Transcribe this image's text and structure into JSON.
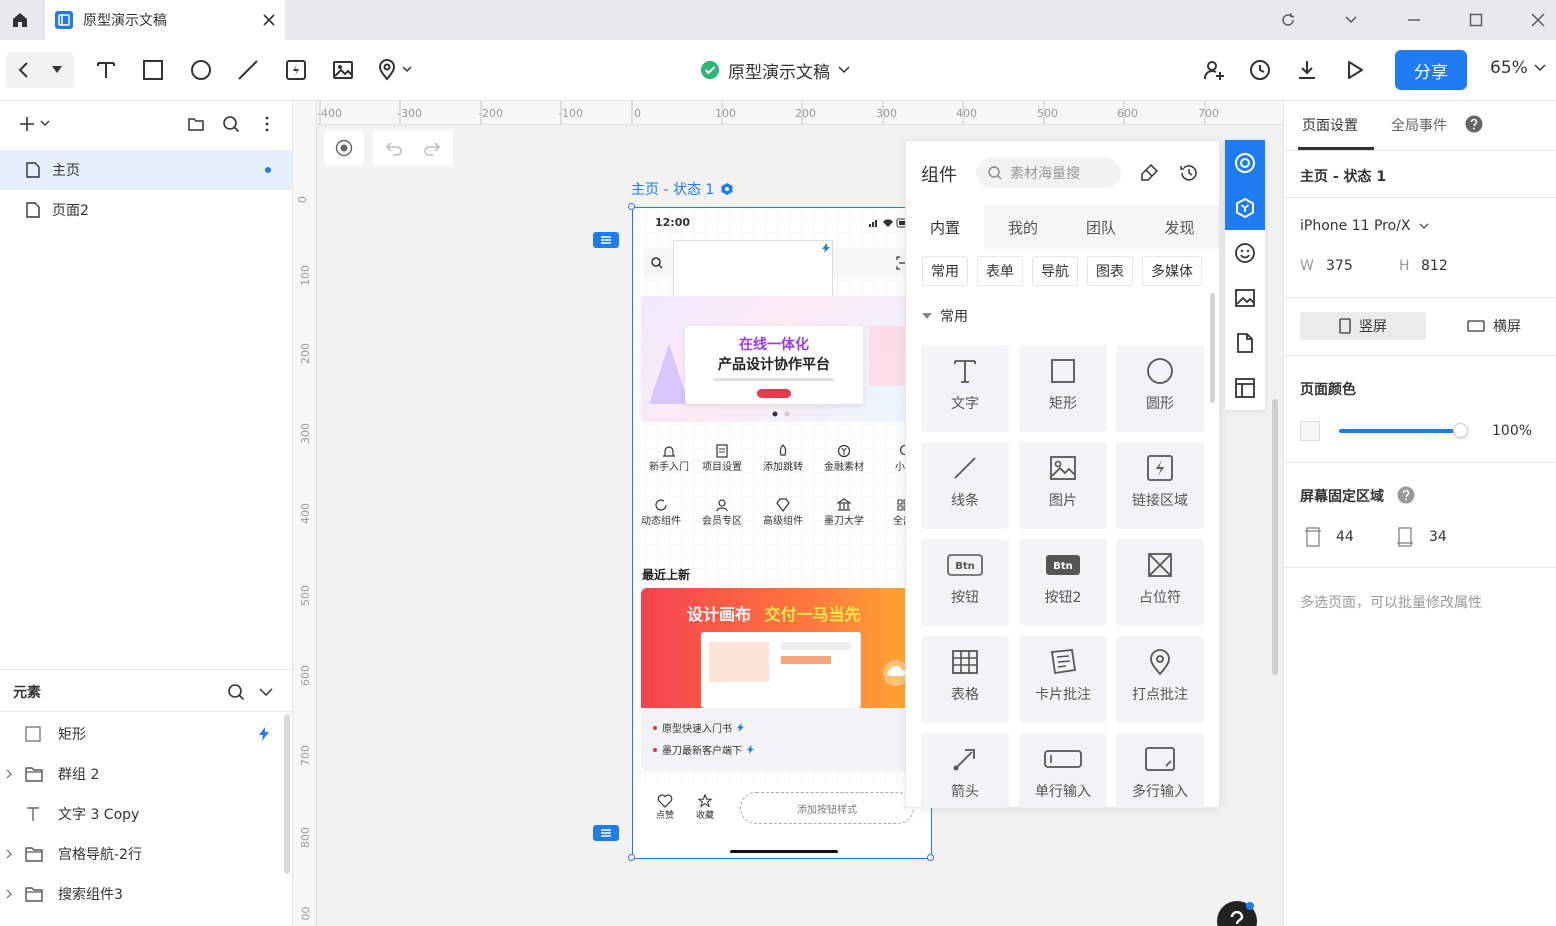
{
  "window": {
    "tab_title": "原型演示文稿"
  },
  "toolbar": {
    "doc_title": "原型演示文稿",
    "share_label": "分享",
    "zoom": "65%"
  },
  "pages_panel": {
    "pages": [
      {
        "label": "主页",
        "active": true
      },
      {
        "label": "页面2",
        "active": false
      }
    ]
  },
  "elements_panel": {
    "title": "元素",
    "items": [
      {
        "label": "矩形",
        "icon": "rect-icon",
        "expandable": false
      },
      {
        "label": "群组 2",
        "icon": "folder-icon",
        "expandable": true
      },
      {
        "label": "文字 3 Copy",
        "icon": "text-icon",
        "expandable": false
      },
      {
        "label": "宫格导航-2行",
        "icon": "folder-icon",
        "expandable": true
      },
      {
        "label": "搜索组件3",
        "icon": "folder-icon",
        "expandable": true
      }
    ]
  },
  "canvas": {
    "ruler_h": [
      "-400",
      "-300",
      "-200",
      "-100",
      "0",
      "100",
      "200",
      "300",
      "400",
      "500",
      "600",
      "700"
    ],
    "ruler_v": [
      "0",
      "100",
      "200",
      "300",
      "400",
      "500",
      "600",
      "700",
      "800",
      "00"
    ],
    "frame_label": "主页 - 状态 1"
  },
  "phone": {
    "time": "12:00",
    "banner_title_1": "在线一体化",
    "banner_title_2": "产品设计协作平台",
    "nav_row1": [
      "新手入门",
      "项目设置",
      "添加跳转",
      "金融素材",
      "小技"
    ],
    "nav_row2": [
      "动态组件",
      "会员专区",
      "高级组件",
      "墨刀大学",
      "全部"
    ],
    "recent_title": "最近上新",
    "promo_title_1": "设计画布",
    "promo_title_2": "交付一马当先",
    "list": [
      "原型快速入门书",
      "墨刀最新客户端下"
    ],
    "bottom": {
      "like": "点赞",
      "fav": "收藏",
      "button": "添加按钮样式"
    }
  },
  "components_panel": {
    "title": "组件",
    "search_placeholder": "素材海量搜",
    "tabs": [
      "内置",
      "我的",
      "团队",
      "发现"
    ],
    "categories": [
      "常用",
      "表单",
      "导航",
      "图表",
      "多媒体"
    ],
    "section": "常用",
    "tiles": [
      {
        "label": "文字",
        "icon": "text-icon"
      },
      {
        "label": "矩形",
        "icon": "rectangle-icon"
      },
      {
        "label": "圆形",
        "icon": "circle-icon"
      },
      {
        "label": "线条",
        "icon": "line-icon"
      },
      {
        "label": "图片",
        "icon": "image-icon"
      },
      {
        "label": "链接区域",
        "icon": "link-area-icon"
      },
      {
        "label": "按钮",
        "icon": "button-outline-icon"
      },
      {
        "label": "按钮2",
        "icon": "button-filled-icon"
      },
      {
        "label": "占位符",
        "icon": "placeholder-icon"
      },
      {
        "label": "表格",
        "icon": "table-icon"
      },
      {
        "label": "卡片批注",
        "icon": "card-note-icon"
      },
      {
        "label": "打点批注",
        "icon": "pin-note-icon"
      },
      {
        "label": "箭头",
        "icon": "arrow-icon"
      },
      {
        "label": "单行输入",
        "icon": "input-icon"
      },
      {
        "label": "多行输入",
        "icon": "textarea-icon"
      }
    ],
    "btn_text": "Btn"
  },
  "right_panel": {
    "tabs": [
      "页面设置",
      "全局事件"
    ],
    "state_title": "主页 - 状态 1",
    "device": "iPhone 11 Pro/X",
    "w_label": "W",
    "w_value": "375",
    "h_label": "H",
    "h_value": "812",
    "portrait": "竖屏",
    "landscape": "横屏",
    "page_color_label": "页面颜色",
    "opacity": "100%",
    "opacity_level": 1.0,
    "fixed_area_label": "屏幕固定区域",
    "top_fixed": "44",
    "bottom_fixed": "34",
    "hint": "多选页面，可以批量修改属性"
  },
  "colors": {
    "accent": "#1e7bf2",
    "selection_bg": "#e6f0fd"
  }
}
